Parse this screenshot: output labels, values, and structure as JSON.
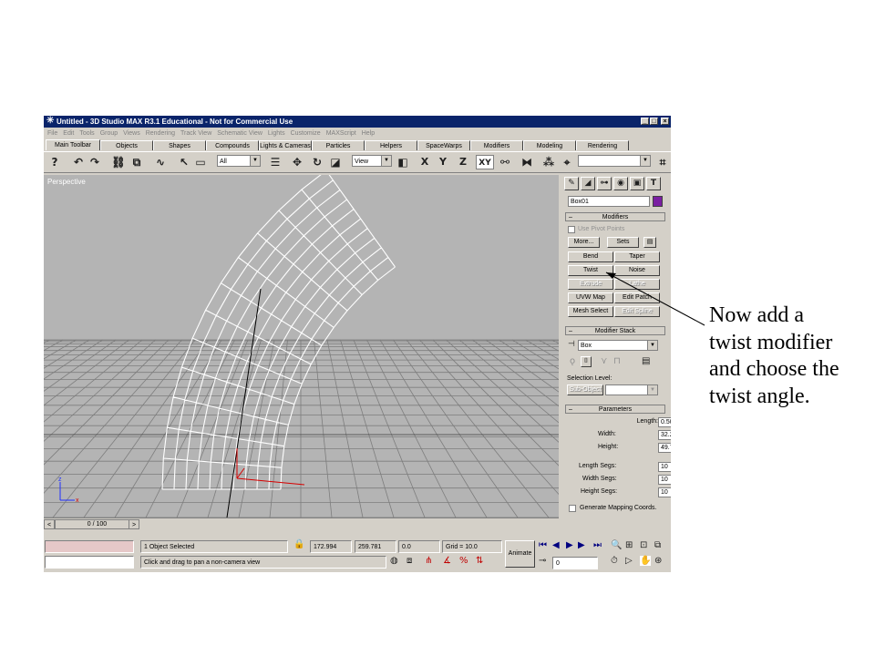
{
  "window": {
    "title": "Untitled - 3D Studio MAX R3.1 Educational - Not for Commercial Use",
    "controls": [
      "_",
      "□",
      "×"
    ]
  },
  "menu": [
    "File",
    "Edit",
    "Tools",
    "Group",
    "Views",
    "Rendering",
    "Track View",
    "Schematic View",
    "Lights",
    "Customize",
    "MAXScript",
    "Help"
  ],
  "tabs": [
    "Main Toolbar",
    "Objects",
    "Shapes",
    "Compounds",
    "Lights & Cameras",
    "Particles",
    "Helpers",
    "SpaceWarps",
    "Modifiers",
    "Modeling",
    "Rendering"
  ],
  "toolbar": {
    "selection_filter": "All",
    "reference_coord": "View",
    "axis_x": "X",
    "axis_y": "Y",
    "axis_z": "Z",
    "axis_xy": "XY"
  },
  "viewport": {
    "label": "Perspective",
    "axis_z": "z",
    "axis_x": "x"
  },
  "timeslider": {
    "frame": "0 / 100"
  },
  "command_panel": {
    "object_name": "Box01",
    "object_color": "#7a1fa2",
    "modifiers": {
      "title": "Modifiers",
      "use_pivot_points": "Use Pivot Points",
      "more": "More...",
      "sets": "Sets",
      "buttons": [
        "Bend",
        "Taper",
        "Twist",
        "Noise",
        "Extrude",
        "Lathe",
        "UVW Map",
        "Edit Patch",
        "Mesh Select",
        "Edit Spline"
      ]
    },
    "modifier_stack": {
      "title": "Modifier Stack",
      "current": "Box",
      "selection_level": "Selection Level:",
      "sub_object": "Sub-Object"
    },
    "parameters": {
      "title": "Parameters",
      "length_label": "Length:",
      "length": "0.509",
      "width_label": "Width:",
      "width": "32.247",
      "height_label": "Height:",
      "height": "49.707",
      "length_segs_label": "Length Segs:",
      "length_segs": "10",
      "width_segs_label": "Width Segs:",
      "width_segs": "10",
      "height_segs_label": "Height Segs:",
      "height_segs": "10",
      "generate_mapping": "Generate Mapping Coords."
    }
  },
  "statusbar": {
    "selected": "1 Object Selected",
    "x": "172.994",
    "y": "259.781",
    "z": "0.0",
    "grid": "Grid = 10.0",
    "animate": "Animate",
    "prompt": "Click and drag to pan a non-camera view",
    "frame": "0"
  },
  "annotation": {
    "text": "Now add a twist modifier and choose the twist angle."
  }
}
